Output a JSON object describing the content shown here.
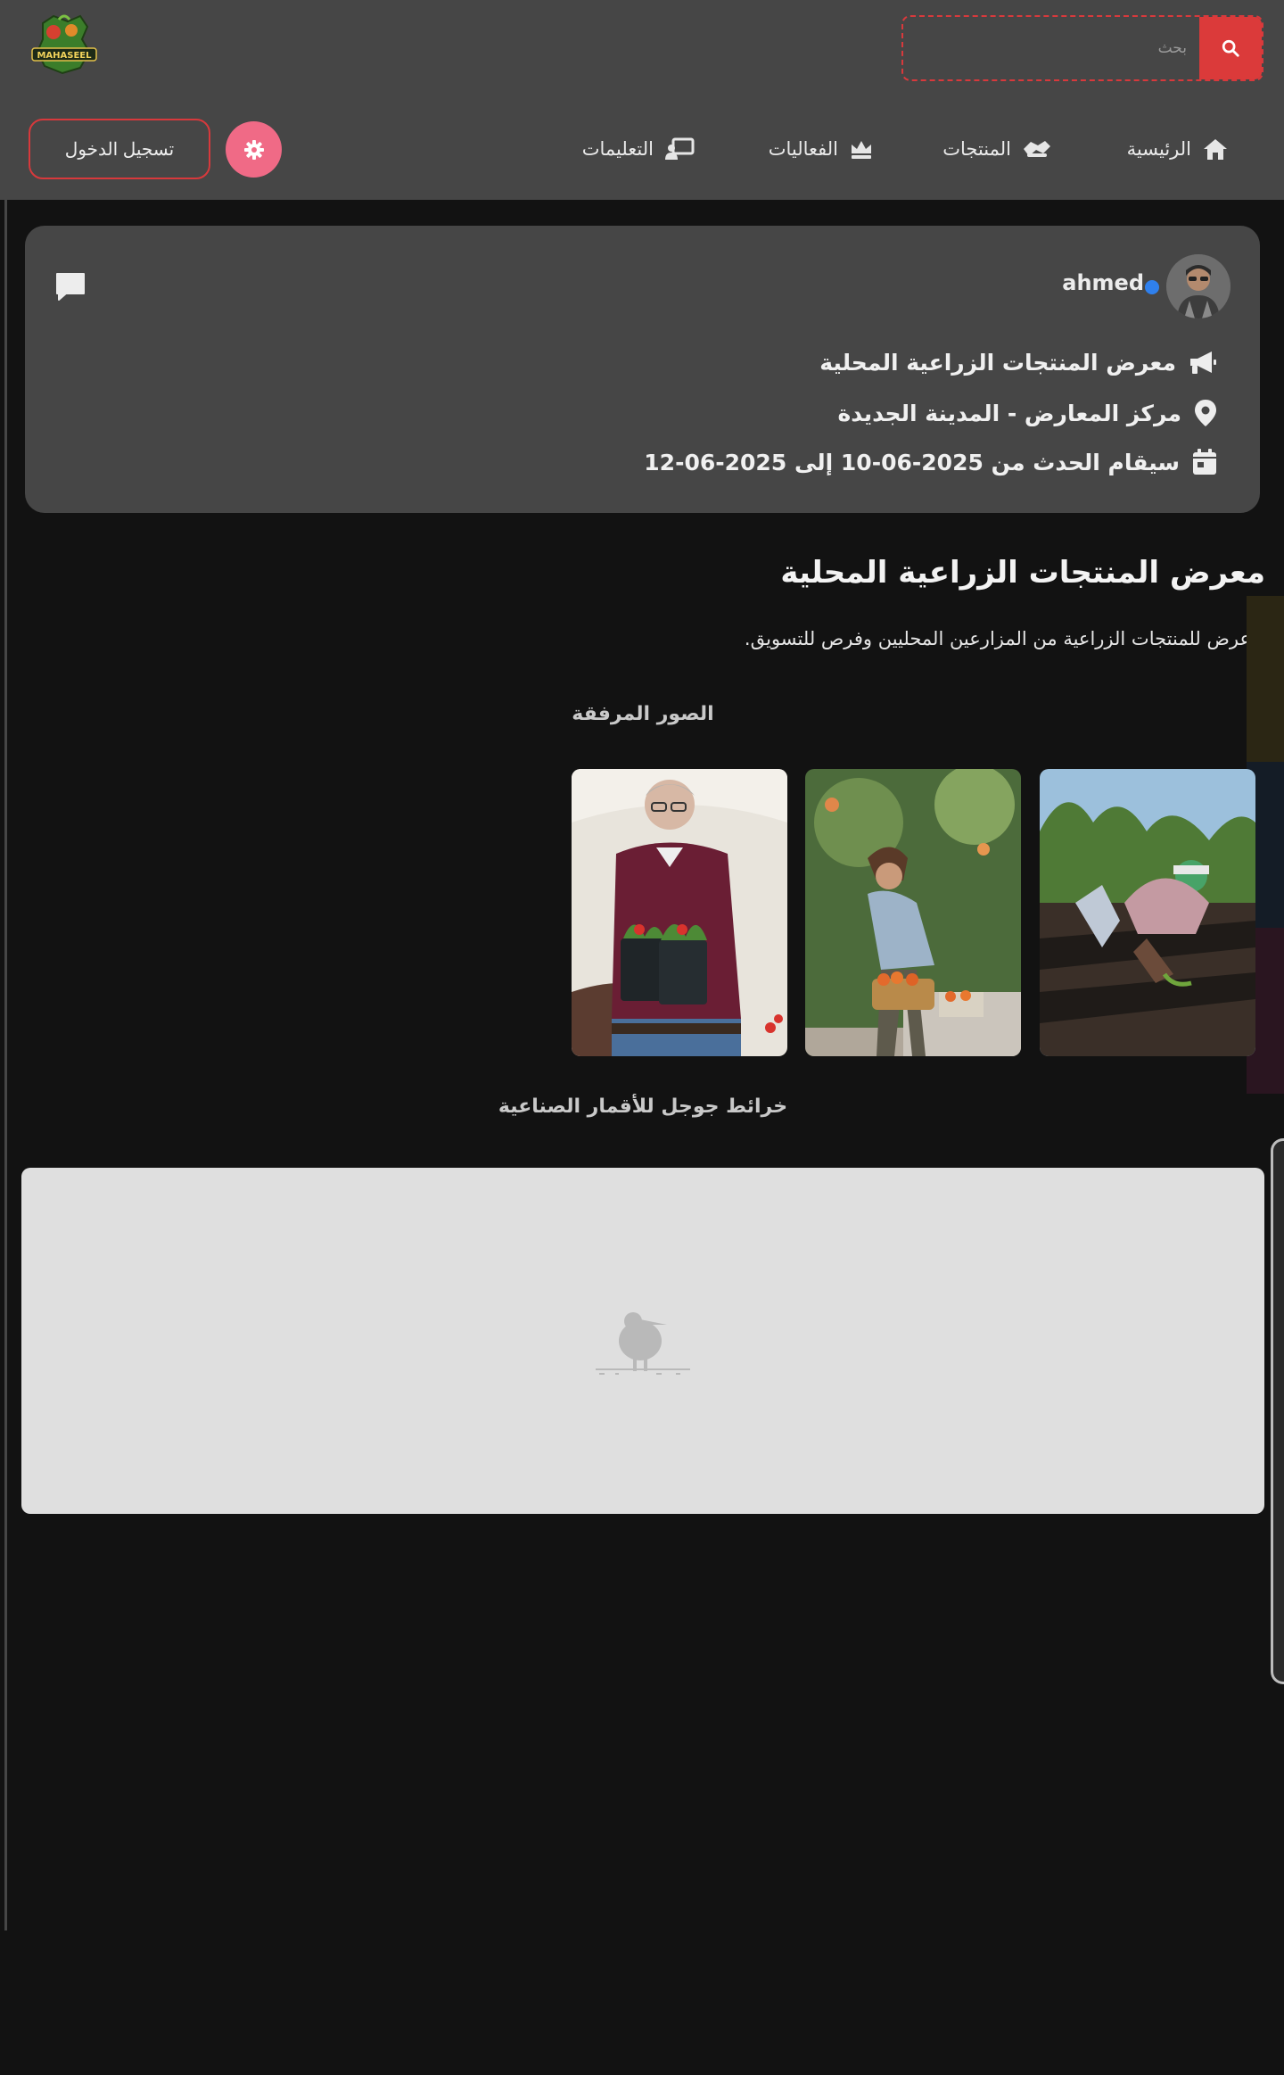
{
  "header": {
    "search_placeholder": "بحث",
    "search_icon": "search-icon",
    "logo_icon": "mahaseel-logo-icon",
    "settings_icon": "gear-icon",
    "login_label": "تسجيل الدخول"
  },
  "nav": {
    "items": [
      {
        "label": "الرئيسية",
        "icon": "home-icon"
      },
      {
        "label": "المنتجات",
        "icon": "handshake-icon"
      },
      {
        "label": "الفعاليات",
        "icon": "crown-icon"
      },
      {
        "label": "التعليمات",
        "icon": "teacher-icon"
      }
    ]
  },
  "event": {
    "author": "ahmed",
    "title_row": "معرض المنتجات الزراعية المحلية",
    "location": "مركز المعارض - المدينة الجديدة",
    "date_text": "سيقام الحدث من 2025-06-10 إلى 2025-06-12"
  },
  "page": {
    "title": "معرض المنتجات الزراعية المحلية",
    "description": "عرض للمنتجات الزراعية من المزارعين المحليين وفرص للتسويق.",
    "photos_title": "الصور المرفقة",
    "map_title": "خرائط جوجل للأقمار الصناعية"
  },
  "colors": {
    "accent": "#db3a3a",
    "settings": "#f06a86",
    "verified": "#2f80ed",
    "header_bg": "#464646",
    "page_bg": "#121212"
  }
}
